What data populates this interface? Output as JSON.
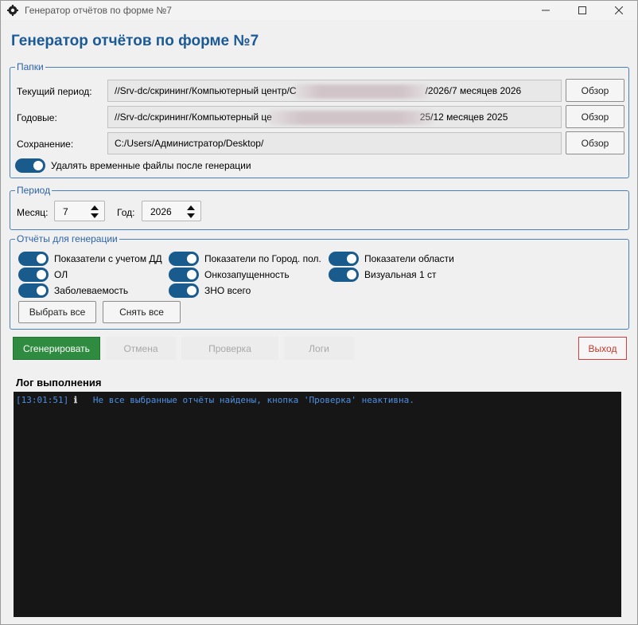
{
  "window": {
    "title": "Генератор отчётов по форме №7"
  },
  "heading": "Генератор отчётов по форме №7",
  "folders": {
    "legend": "Папки",
    "rows": [
      {
        "label": "Текущий период:",
        "value_start": "//Srv-dc/скрининг/Компьютерный центр/С",
        "value_end": "/2026/7 месяцев 2026",
        "browse": "Обзор"
      },
      {
        "label": "Годовые:",
        "value_start": "//Srv-dc/скрининг/Компьютерный це",
        "value_end": "25/12 месяцев 2025",
        "browse": "Обзор"
      },
      {
        "label": "Сохранение:",
        "value": "C:/Users/Администратор/Desktop/",
        "browse": "Обзор"
      }
    ],
    "delete_temp": {
      "label": "Удалять временные файлы после генерации",
      "checked": true
    }
  },
  "period": {
    "legend": "Период",
    "month_label": "Месяц:",
    "month": "7",
    "year_label": "Год:",
    "year": "2026"
  },
  "reports": {
    "legend": "Отчёты для генерации",
    "items": [
      {
        "label": "Показатели с учетом ДД",
        "checked": true
      },
      {
        "label": "ОЛ",
        "checked": true
      },
      {
        "label": "Заболеваемость",
        "checked": true
      },
      {
        "label": "Показатели по Город. пол.",
        "checked": true
      },
      {
        "label": "Онкозапущенность",
        "checked": true
      },
      {
        "label": "ЗНО всего",
        "checked": true
      },
      {
        "label": "Показатели области",
        "checked": true
      },
      {
        "label": "Визуальная 1 ст",
        "checked": true
      }
    ],
    "select_all": "Выбрать все",
    "clear_all": "Снять все"
  },
  "actions": {
    "generate": "Сгенерировать",
    "cancel": "Отмена",
    "check": "Проверка",
    "logs": "Логи",
    "exit": "Выход"
  },
  "log": {
    "title": "Лог выполнения",
    "entries": [
      {
        "time": "[13:01:51]",
        "icon": "ℹ",
        "message": "Не все выбранные отчёты найдены, кнопка 'Проверка' неактивна."
      }
    ]
  },
  "colors": {
    "accent": "#1c5a96",
    "toggle_on": "#1a5b8e",
    "generate_bg": "#2e8b3f",
    "exit_border": "#d23d3d",
    "log_bg": "#161616",
    "log_text": "#4f8fe0"
  }
}
